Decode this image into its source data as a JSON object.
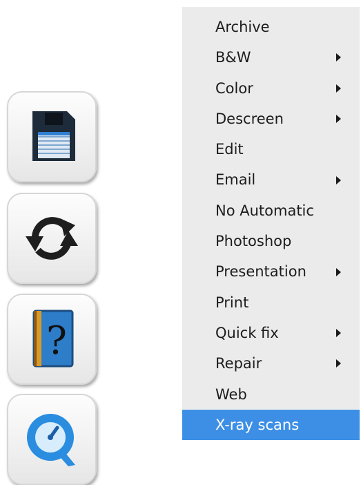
{
  "toolbar": {
    "buttons": [
      {
        "icon": "floppy-disk-icon"
      },
      {
        "icon": "sync-arrows-icon"
      },
      {
        "icon": "help-book-icon",
        "glyph": "?"
      },
      {
        "icon": "quicktime-icon"
      }
    ]
  },
  "menu": {
    "items": [
      {
        "label": "Archive",
        "has_submenu": false
      },
      {
        "label": "B&W",
        "has_submenu": true
      },
      {
        "label": "Color",
        "has_submenu": true
      },
      {
        "label": "Descreen",
        "has_submenu": true
      },
      {
        "label": "Edit",
        "has_submenu": false
      },
      {
        "label": "Email",
        "has_submenu": true
      },
      {
        "label": "No Automatic",
        "has_submenu": false
      },
      {
        "label": "Photoshop",
        "has_submenu": false
      },
      {
        "label": "Presentation",
        "has_submenu": true
      },
      {
        "label": "Print",
        "has_submenu": false
      },
      {
        "label": "Quick fix",
        "has_submenu": true
      },
      {
        "label": "Repair",
        "has_submenu": true
      },
      {
        "label": "Web",
        "has_submenu": false
      },
      {
        "label": "X-ray scans",
        "has_submenu": false,
        "selected": true
      }
    ]
  },
  "colors": {
    "menu_background": "#ebebeb",
    "selection": "#3d8fe6",
    "menu_text": "#1c1c1c"
  }
}
